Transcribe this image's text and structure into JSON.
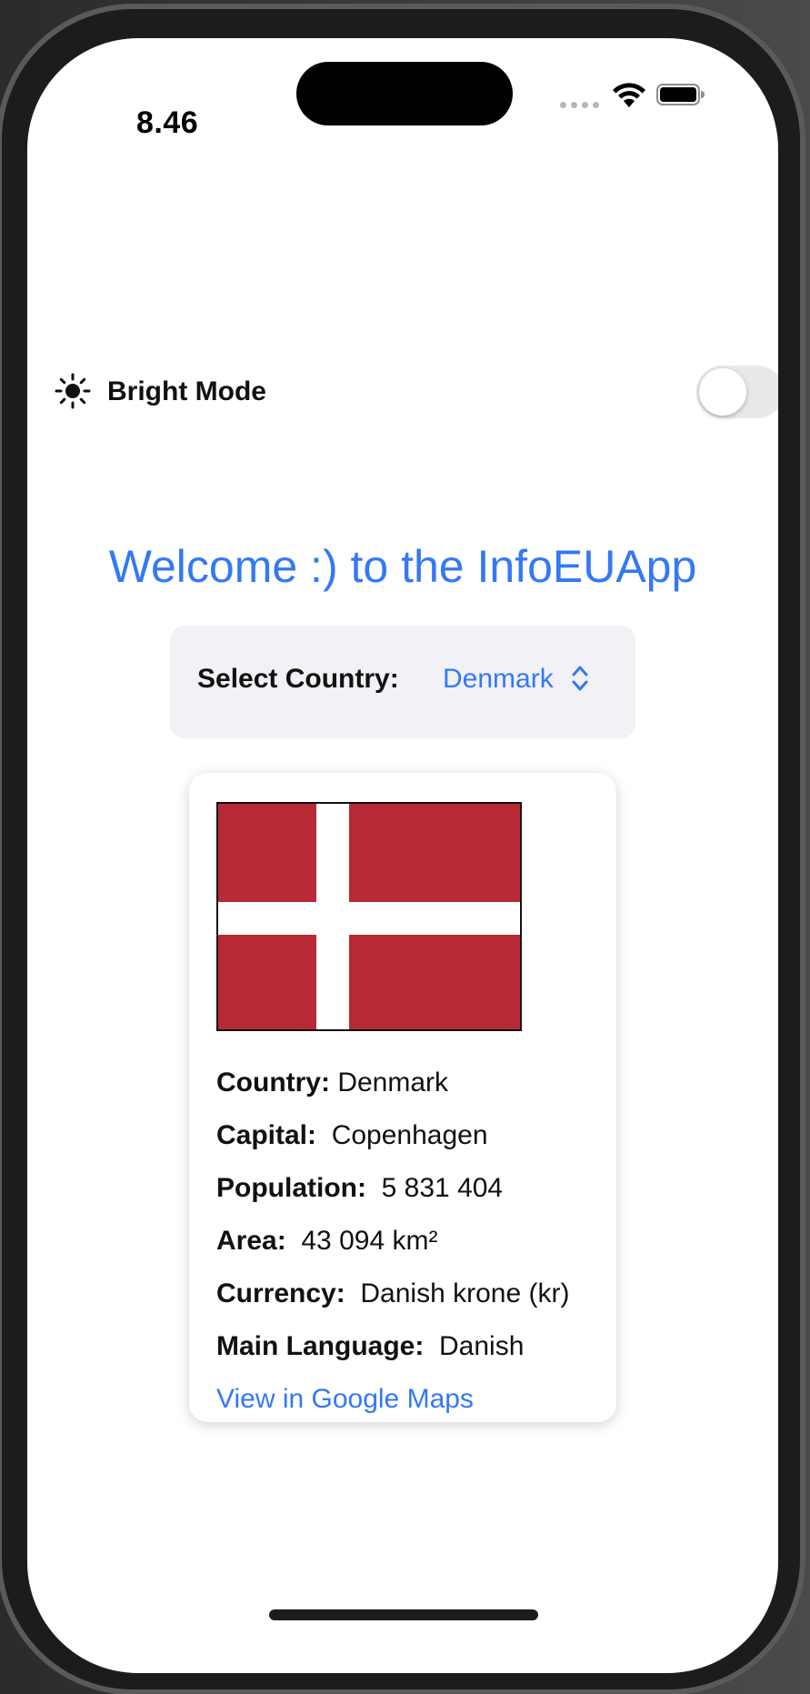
{
  "status_bar": {
    "time": "8.46"
  },
  "settings": {
    "bright_mode_label": "Bright Mode",
    "bright_mode_on": false
  },
  "welcome_title": "Welcome :) to the InfoEUApp",
  "picker": {
    "label": "Select Country:",
    "selected": "Denmark"
  },
  "country_card": {
    "flag_colors": {
      "red": "#b72a35",
      "white": "#ffffff"
    },
    "fields": [
      {
        "label": "Country:",
        "value": "Denmark"
      },
      {
        "label": "Capital:",
        "value": "Copenhagen"
      },
      {
        "label": "Population:",
        "value": "5 831 404"
      },
      {
        "label": "Area:",
        "value": "43 094 km²"
      },
      {
        "label": "Currency:",
        "value": "Danish krone (kr)"
      },
      {
        "label": "Main Language:",
        "value": "Danish"
      }
    ],
    "maps_link": "View in Google Maps"
  },
  "colors": {
    "accent": "#3478f6",
    "picker_bg": "#f1f1f6",
    "switch_off": "#e9e9eb"
  }
}
